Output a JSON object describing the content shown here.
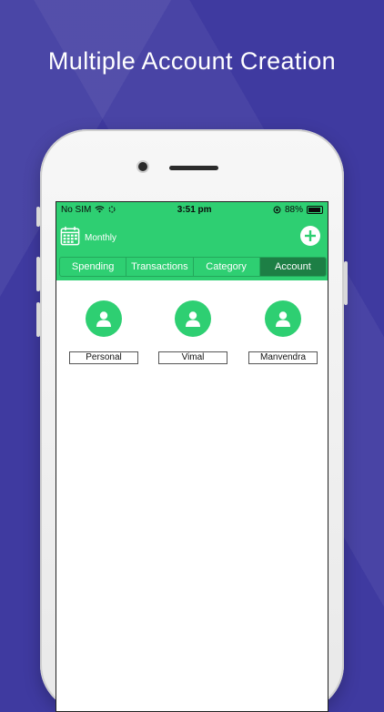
{
  "headline": "Multiple Account Creation",
  "status_bar": {
    "carrier": "No SIM",
    "time": "3:51 pm",
    "battery": "88%"
  },
  "header": {
    "period_label": "Monthly"
  },
  "tabs": [
    {
      "label": "Spending",
      "active": false
    },
    {
      "label": "Transactions",
      "active": false
    },
    {
      "label": "Category",
      "active": false
    },
    {
      "label": "Account",
      "active": true
    }
  ],
  "accounts": [
    {
      "name": "Personal"
    },
    {
      "name": "Vimal"
    },
    {
      "name": "Manvendra"
    }
  ],
  "colors": {
    "background": "#3f3aa0",
    "accent_green": "#2ecf72",
    "active_tab": "#1d7f45"
  },
  "icons": {
    "calendar": "calendar-icon",
    "add": "plus-circle-icon",
    "avatar": "user-icon",
    "wifi": "wifi-icon",
    "battery": "battery-icon"
  }
}
